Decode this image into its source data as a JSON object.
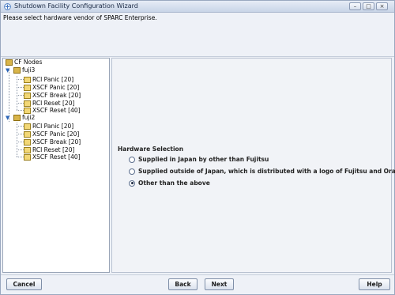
{
  "window": {
    "title": "Shutdown Facility Configuration Wizard"
  },
  "instruction": "Please select hardware vendor of SPARC Enterprise.",
  "tree": {
    "root": "CF Nodes",
    "nodes": [
      {
        "name": "fuji3",
        "children": [
          "RCI Panic [20]",
          "XSCF Panic [20]",
          "XSCF Break [20]",
          "RCI Reset [20]",
          "XSCF Reset [40]"
        ]
      },
      {
        "name": "fuji2",
        "children": [
          "RCI Panic [20]",
          "XSCF Panic [20]",
          "XSCF Break [20]",
          "RCI Reset [20]",
          "XSCF Reset [40]"
        ]
      }
    ]
  },
  "hardware_selection": {
    "label": "Hardware Selection",
    "options": [
      {
        "label": "Supplied in Japan by other than Fujitsu",
        "selected": false
      },
      {
        "label": "Supplied outside of Japan, which is distributed with a logo of Fujitsu and Oracle",
        "selected": false
      },
      {
        "label": "Other than the above",
        "selected": true
      }
    ]
  },
  "buttons": {
    "cancel": "Cancel",
    "back": "Back",
    "next": "Next",
    "help": "Help"
  }
}
